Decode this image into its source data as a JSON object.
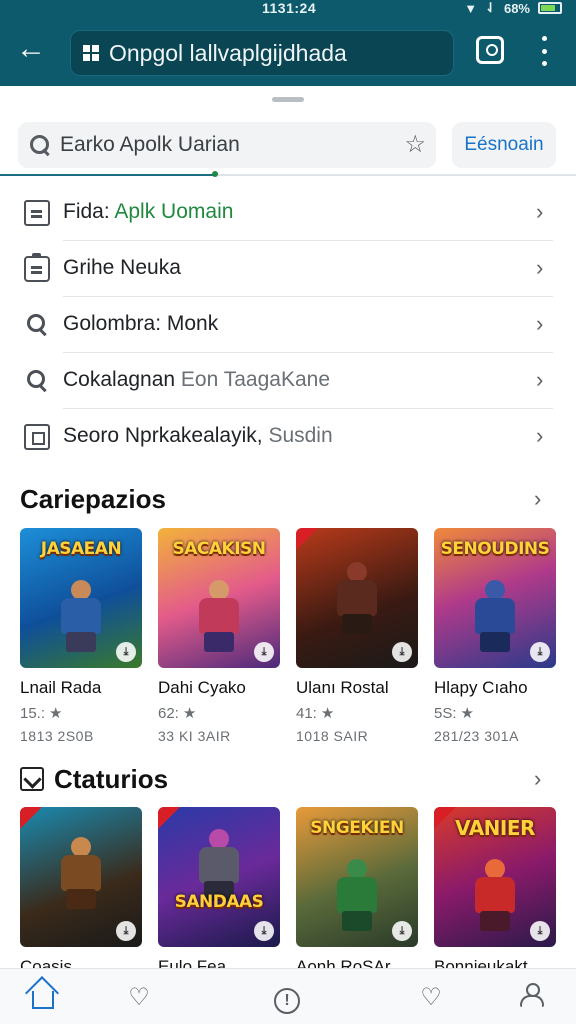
{
  "status": {
    "time": "1131:24",
    "battery_text": "68%"
  },
  "appbar": {
    "url": "Onpgol lallvaplgĳdhada"
  },
  "search": {
    "query": "Earko Apolk Uarian",
    "action_label": "Eésnoain"
  },
  "suggestions": [
    {
      "prefix": "Fida: ",
      "highlight": "Aplk Uomain",
      "rest": ""
    },
    {
      "prefix": "Grihe Neuka",
      "highlight": "",
      "rest": ""
    },
    {
      "prefix": "Golombra: Monk",
      "highlight": "",
      "rest": ""
    },
    {
      "prefix": "Cokalagnan ",
      "highlight": "",
      "rest": "Eon TaagaKane"
    },
    {
      "prefix": "Seoro Nprkakealayik, ",
      "highlight": "",
      "rest": "Susdin"
    }
  ],
  "sections": {
    "first_title": "Cariepazios",
    "second_title": "Ctaturios"
  },
  "apps_row1": [
    {
      "title_art": "JASAEAN",
      "name": "Lnail Rada",
      "rating": "15.:",
      "size": "1813 2S0B"
    },
    {
      "title_art": "SACAKISN",
      "name": "Dahi Cyako",
      "rating": "62:",
      "size": "33 KI 3AIR"
    },
    {
      "title_art": "",
      "name": "Ulanı Rostal",
      "rating": "41:",
      "size": "1018 SAIR"
    },
    {
      "title_art": "SENOUDINS",
      "name": "Hlapy Cıaho",
      "rating": "5S:",
      "size": "281/23 301A"
    }
  ],
  "apps_row2": [
    {
      "title_art": "",
      "name": "Coasis",
      "rating": "",
      "size": ""
    },
    {
      "title_art": "SANDAAS",
      "name": "Eulo Fea",
      "rating": "",
      "size": ""
    },
    {
      "title_art": "SNGEKIEN",
      "name": "Aonh RoSAr",
      "rating": "",
      "size": ""
    },
    {
      "title_art": "VANIER",
      "name": "Bonnieukakt",
      "rating": "",
      "size": ""
    }
  ],
  "colors": {
    "appbar": "#0d5a6c",
    "accent": "#1a73c9",
    "highlight": "#1f8a3e"
  }
}
